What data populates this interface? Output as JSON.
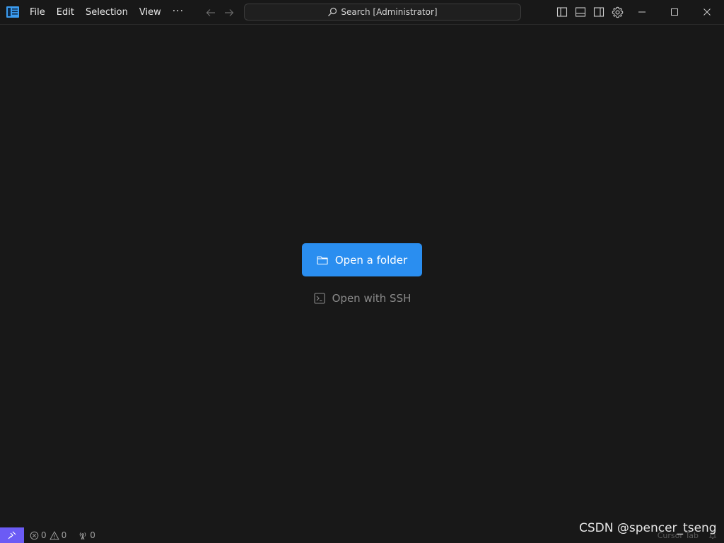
{
  "menu": {
    "items": [
      "File",
      "Edit",
      "Selection",
      "View"
    ],
    "more": "···"
  },
  "search": {
    "label": "Search [Administrator]"
  },
  "icons": {
    "logo": "editor-logo-icon",
    "back": "arrow-left-icon",
    "forward": "arrow-right-icon",
    "search": "search-icon",
    "layout": [
      "toggle-primary-sidebar-icon",
      "toggle-panel-icon",
      "toggle-secondary-sidebar-icon",
      "gear-icon"
    ],
    "window": [
      "minimize-icon",
      "maximize-icon",
      "close-icon"
    ]
  },
  "main": {
    "open_folder_label": "Open a folder",
    "open_ssh_label": "Open with SSH"
  },
  "status": {
    "errors": "0",
    "warnings": "0",
    "ports": "0",
    "right_label": "Cursor Tab"
  },
  "watermark": "CSDN @spencer_tseng",
  "colors": {
    "accent": "#2a8ef0",
    "remote": "#6b5bf5",
    "background": "#181818"
  }
}
